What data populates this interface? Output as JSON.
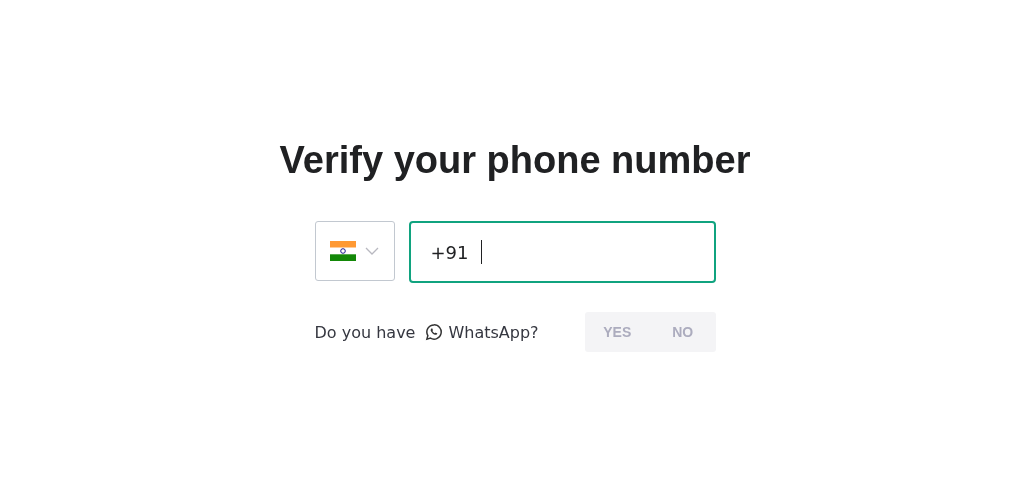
{
  "title": "Verify your phone number",
  "phone": {
    "value": "+91",
    "focused": true
  },
  "whatsapp": {
    "prefix": "Do you have",
    "label": "WhatsApp?",
    "options": [
      {
        "label": "YES",
        "selected": false
      },
      {
        "label": "NO",
        "selected": false
      }
    ]
  }
}
